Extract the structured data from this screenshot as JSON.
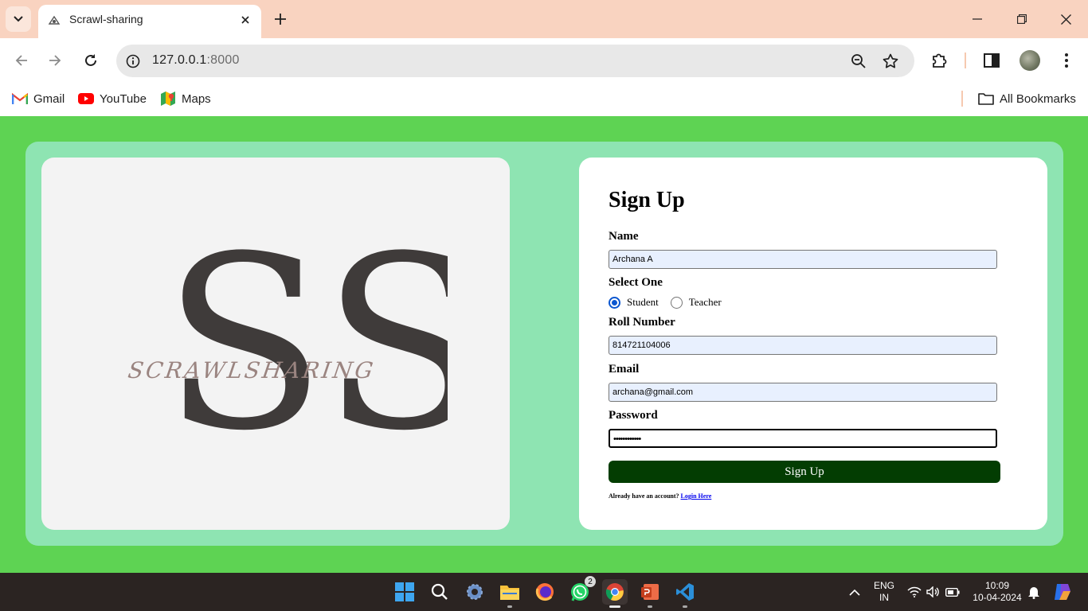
{
  "browser": {
    "tab_title": "Scrawl-sharing",
    "url_host": "127.0.0.1",
    "url_port": ":8000",
    "bookmarks": [
      {
        "label": "Gmail",
        "icon": "gmail-icon"
      },
      {
        "label": "YouTube",
        "icon": "youtube-icon"
      },
      {
        "label": "Maps",
        "icon": "maps-icon"
      }
    ],
    "all_bookmarks_label": "All Bookmarks"
  },
  "logo": {
    "monogram": "SS",
    "wordmark": "SCRAWLSHARING"
  },
  "form": {
    "title": "Sign Up",
    "name_label": "Name",
    "name_value": "Archana A",
    "select_label": "Select One",
    "role_options": [
      "Student",
      "Teacher"
    ],
    "selected_role": "Student",
    "roll_label": "Roll Number",
    "roll_value": "814721104006",
    "email_label": "Email",
    "email_value": "archana@gmail.com",
    "password_label": "Password",
    "password_value": "••••••••••••",
    "submit_label": "Sign Up",
    "login_prompt": "Already have an account?",
    "login_link": "Login Here"
  },
  "taskbar": {
    "whatsapp_badge": "2",
    "language_line1": "ENG",
    "language_line2": "IN",
    "time": "10:09",
    "date": "10-04-2024"
  },
  "colors": {
    "page_bg": "#5ed353",
    "card_bg": "#8ee4b2",
    "button_bg": "#033d02",
    "tabbar_bg": "#f9d3c0"
  }
}
